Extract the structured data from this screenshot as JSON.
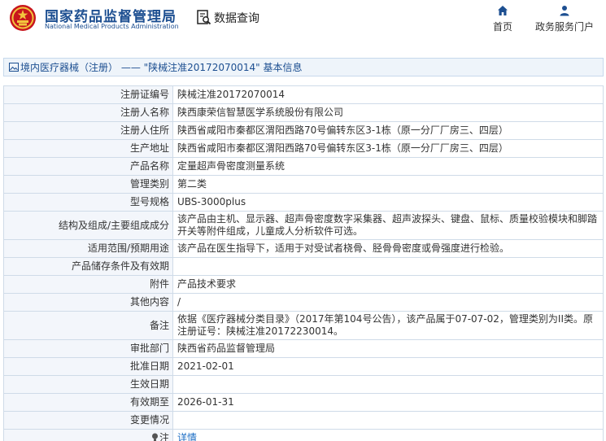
{
  "header": {
    "brand_cn": "国家药品监督管理局",
    "brand_en": "National Medical Products Administration",
    "module_title": "数据查询",
    "nav": [
      {
        "label": "首页",
        "icon": "home-icon"
      },
      {
        "label": "政务服务门户",
        "icon": "user-icon"
      }
    ]
  },
  "breadcrumb": {
    "text": "境内医疗器械（注册） —— \"陕械注准20172070014\" 基本信息"
  },
  "colors": {
    "brand_blue": "#1d4f91",
    "link_blue": "#1d6ec4",
    "label_bg": "#f3f6fb",
    "border": "#cfdbe8"
  },
  "rows": [
    {
      "label": "注册证编号",
      "value": "陕械注准20172070014"
    },
    {
      "label": "注册人名称",
      "value": "陕西康荣信智慧医学系统股份有限公司"
    },
    {
      "label": "注册人住所",
      "value": "陕西省咸阳市秦都区渭阳西路70号偏转东区3-1栋（原一分厂厂房三、四层）"
    },
    {
      "label": "生产地址",
      "value": "陕西省咸阳市秦都区渭阳西路70号偏转东区3-1栋（原一分厂厂房三、四层）"
    },
    {
      "label": "产品名称",
      "value": "定量超声骨密度测量系统"
    },
    {
      "label": "管理类别",
      "value": "第二类"
    },
    {
      "label": "型号规格",
      "value": "UBS-3000plus"
    },
    {
      "label": "结构及组成/主要组成成分",
      "value": "该产品由主机、显示器、超声骨密度数字采集器、超声波探头、键盘、鼠标、质量校验模块和脚踏开关等附件组成，儿童成人分析软件可选。"
    },
    {
      "label": "适用范围/预期用途",
      "value": "该产品在医生指导下，适用于对受试者桡骨、胫骨骨密度或骨强度进行检验。"
    },
    {
      "label": "产品储存条件及有效期",
      "value": ""
    },
    {
      "label": "附件",
      "value": "产品技术要求"
    },
    {
      "label": "其他内容",
      "value": "/"
    },
    {
      "label": "备注",
      "value": "依据《医疗器械分类目录》（2017年第104号公告），该产品属于07-07-02，管理类别为II类。原注册证号：陕械注准20172230014。"
    },
    {
      "label": "审批部门",
      "value": "陕西省药品监督管理局"
    },
    {
      "label": "批准日期",
      "value": "2021-02-01"
    },
    {
      "label": "生效日期",
      "value": ""
    },
    {
      "label": "有效期至",
      "value": "2026-01-31"
    },
    {
      "label": "变更情况",
      "value": ""
    },
    {
      "label": "注",
      "value": "详情",
      "icon": "lightbulb-icon"
    }
  ]
}
